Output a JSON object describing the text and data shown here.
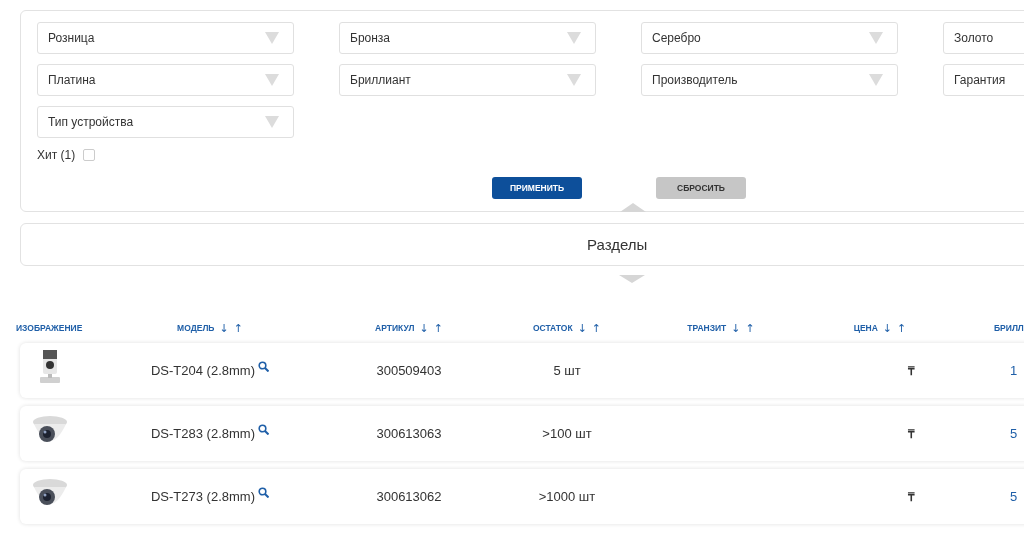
{
  "filters": {
    "fields": [
      {
        "label": "Розница"
      },
      {
        "label": "Бронза"
      },
      {
        "label": "Серебро"
      },
      {
        "label": "Золото"
      },
      {
        "label": "Платина"
      },
      {
        "label": "Бриллиант"
      },
      {
        "label": "Производитель"
      },
      {
        "label": "Гарантия"
      },
      {
        "label": "Тип устройства"
      }
    ],
    "hit": {
      "label": "Хит (1)",
      "checked": false
    },
    "buttons": [
      {
        "label": "ПРИМЕНИТЬ",
        "kind": "primary"
      },
      {
        "label": "СБРОСИТЬ",
        "kind": "secondary"
      }
    ]
  },
  "sections": {
    "title": "Разделы"
  },
  "table": {
    "columns": [
      {
        "label": "ИЗОБРАЖЕНИЕ"
      },
      {
        "label": "МОДЕЛЬ",
        "sort": [
          "↓",
          "↑"
        ]
      },
      {
        "label": "АРТИКУЛ",
        "sort": [
          "↓",
          "↑"
        ]
      },
      {
        "label": "ОСТАТОК",
        "sort": [
          "↓",
          "↑"
        ]
      },
      {
        "label": "ТРАНЗИТ",
        "sort": [
          "↓",
          "↑"
        ]
      },
      {
        "label": "ЦЕНА",
        "sort": [
          "↓",
          "↑"
        ]
      },
      {
        "label": "БРИЛЛ"
      }
    ],
    "rows": [
      {
        "kind": "cube",
        "model": "DS-T204 (2.8mm)",
        "article": "300509403",
        "stock": "5 шт",
        "price": "₸",
        "brill": "1"
      },
      {
        "kind": "dome",
        "model": "DS-T283 (2.8mm)",
        "article": "300613063",
        "stock": ">100 шт",
        "price": "₸",
        "brill": "5"
      },
      {
        "kind": "dome",
        "model": "DS-T273 (2.8mm)",
        "article": "300613062",
        "stock": ">1000 шт",
        "price": "₸",
        "brill": "5"
      }
    ]
  }
}
